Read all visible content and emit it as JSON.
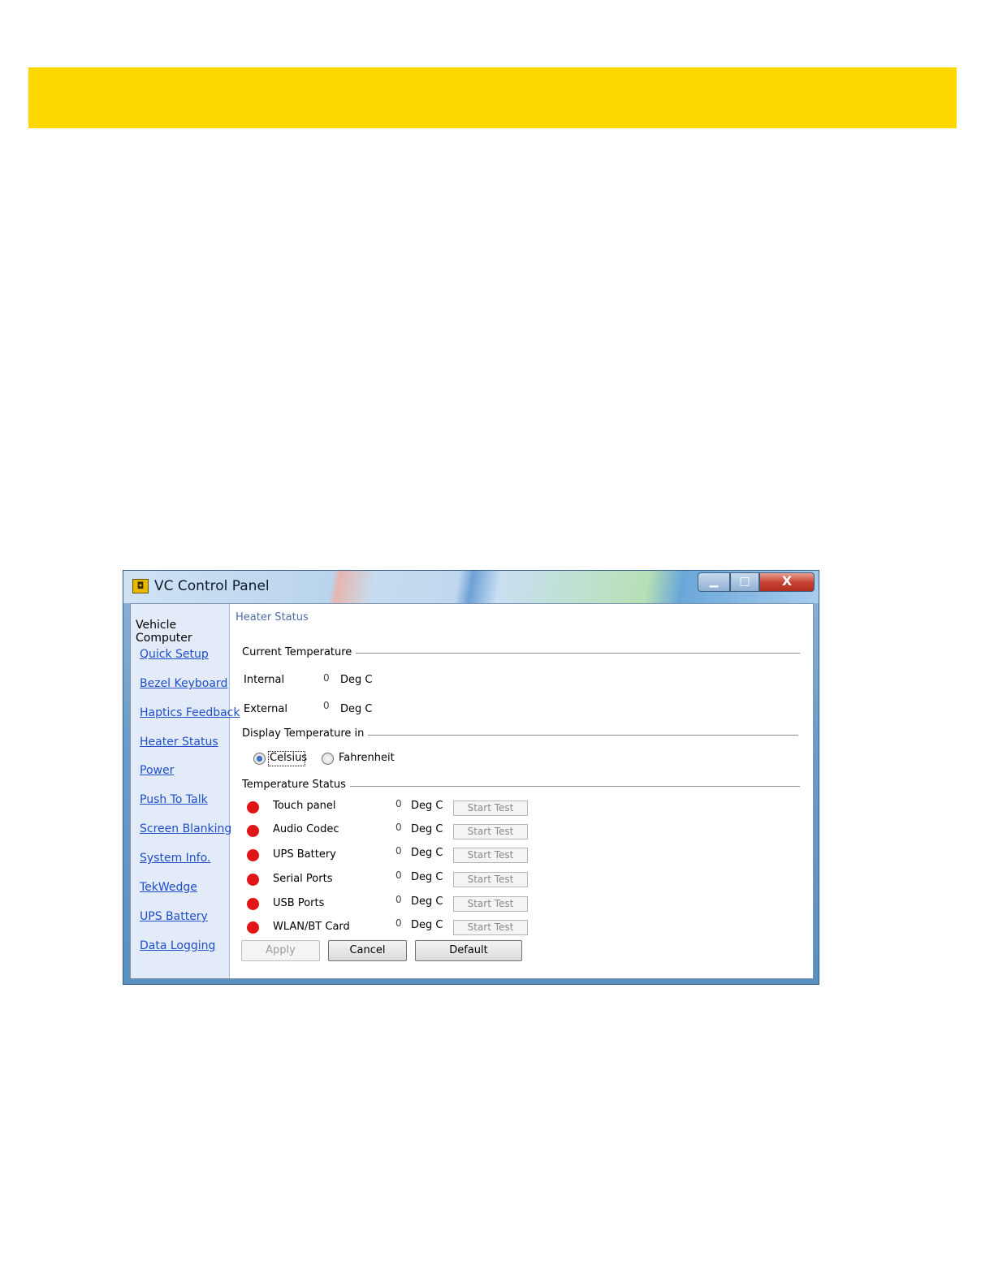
{
  "window": {
    "title": "VC Control Panel",
    "icon": "control-panel-icon",
    "minimize_glyph": "▁",
    "maximize_glyph": "□",
    "close_glyph": "X"
  },
  "sidebar": {
    "header": "Vehicle Computer",
    "items": [
      {
        "label": "Quick Setup"
      },
      {
        "label": "Bezel Keyboard"
      },
      {
        "label": "Haptics Feedback"
      },
      {
        "label": "Heater Status"
      },
      {
        "label": "Power"
      },
      {
        "label": "Push To Talk"
      },
      {
        "label": "Screen Blanking"
      },
      {
        "label": "System Info."
      },
      {
        "label": "TekWedge"
      },
      {
        "label": "UPS Battery"
      },
      {
        "label": "Data Logging"
      }
    ]
  },
  "panel": {
    "title": "Heater Status",
    "current_temperature": {
      "label": "Current Temperature",
      "internal": {
        "label": "Internal",
        "value": "0",
        "unit": "Deg C"
      },
      "external": {
        "label": "External",
        "value": "0",
        "unit": "Deg C"
      }
    },
    "display_in": {
      "label": "Display Temperature in",
      "options": [
        {
          "label": "Celsius",
          "selected": true
        },
        {
          "label": "Fahrenheit",
          "selected": false
        }
      ]
    },
    "temperature_status": {
      "label": "Temperature Status",
      "status_color": "#e01616",
      "rows": [
        {
          "name": "Touch panel",
          "value": "0",
          "unit": "Deg C",
          "button": "Start Test"
        },
        {
          "name": "Audio Codec",
          "value": "0",
          "unit": "Deg C",
          "button": "Start Test"
        },
        {
          "name": "UPS Battery",
          "value": "0",
          "unit": "Deg C",
          "button": "Start Test"
        },
        {
          "name": "Serial Ports",
          "value": "0",
          "unit": "Deg C",
          "button": "Start Test"
        },
        {
          "name": "USB Ports",
          "value": "0",
          "unit": "Deg C",
          "button": "Start Test"
        },
        {
          "name": "WLAN/BT Card",
          "value": "0",
          "unit": "Deg C",
          "button": "Start Test"
        }
      ]
    },
    "buttons": {
      "apply": "Apply",
      "cancel": "Cancel",
      "default": "Default"
    }
  },
  "colors": {
    "banner": "#ffd700",
    "link": "#1f4fc8",
    "sidebar_bg": "#e2ebf7"
  }
}
